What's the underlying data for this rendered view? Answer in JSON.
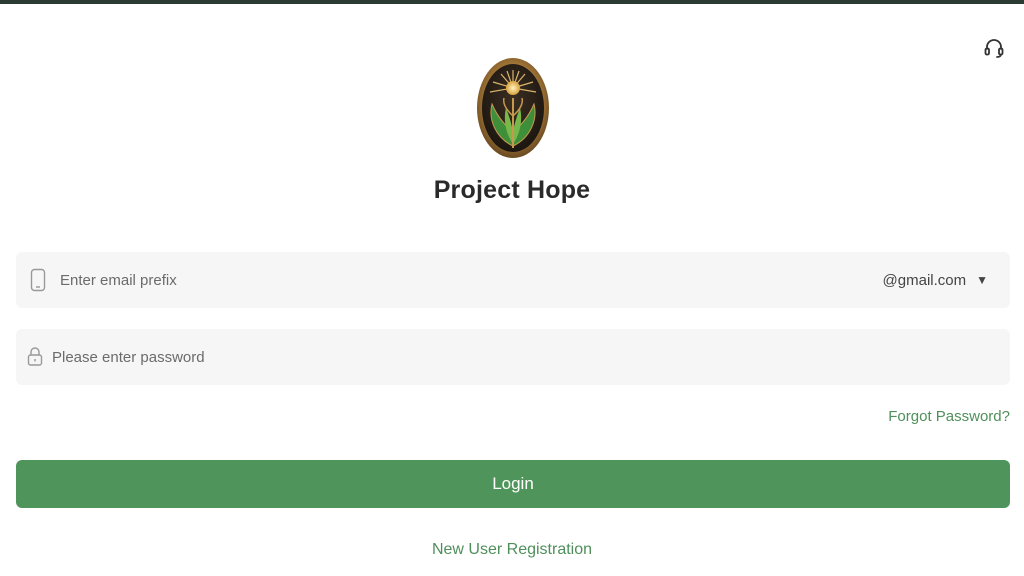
{
  "app": {
    "title": "Project Hope",
    "logo_icon": "project-hope-emblem",
    "support_icon": "headset-icon"
  },
  "login_form": {
    "email": {
      "placeholder": "Enter email prefix",
      "value": "",
      "icon": "phone-icon",
      "domain_selected": "@gmail.com",
      "dropdown_icon": "caret-down-icon"
    },
    "password": {
      "placeholder": "Please enter password",
      "value": "",
      "icon": "lock-icon"
    },
    "forgot_password_label": "Forgot Password?",
    "login_label": "Login",
    "register_label": "New User Registration"
  },
  "colors": {
    "accent": "#4f955b",
    "link": "#4f8f5b",
    "field_bg": "#f6f6f6",
    "top_strip": "#2b3a33"
  }
}
